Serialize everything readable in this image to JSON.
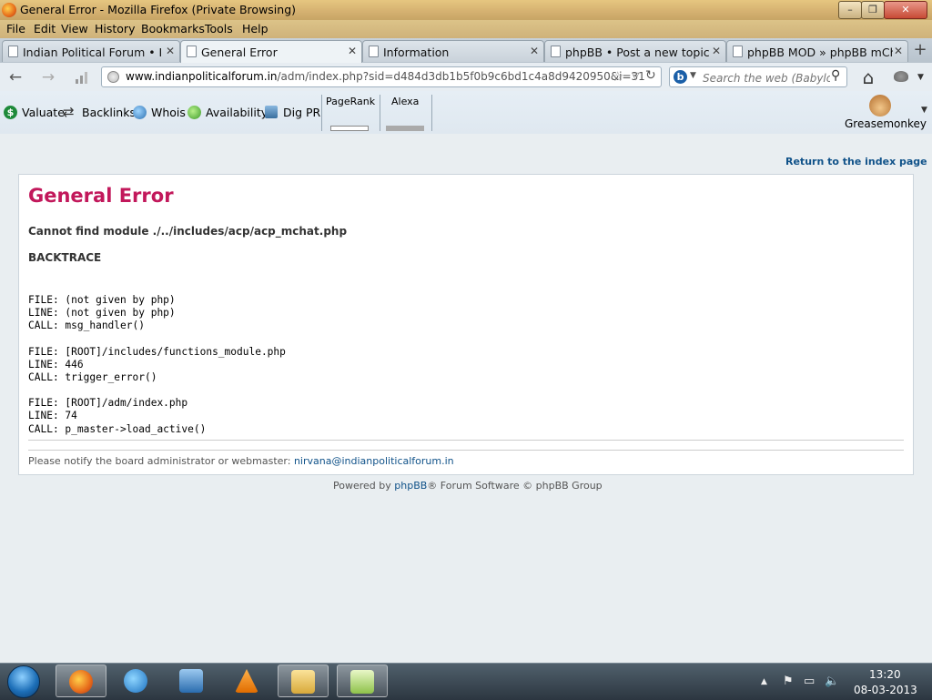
{
  "window": {
    "title": "General Error - Mozilla Firefox (Private Browsing)",
    "min_label": "–",
    "max_label": "❐",
    "close_label": "✕"
  },
  "menu": [
    "File",
    "Edit",
    "View",
    "History",
    "Bookmarks",
    "Tools",
    "Help"
  ],
  "tabs": [
    {
      "label": "Indian Political Forum • Ind...",
      "active": false
    },
    {
      "label": "General Error",
      "active": true
    },
    {
      "label": "Information",
      "active": false
    },
    {
      "label": "phpBB • Post a new topic",
      "active": false
    },
    {
      "label": "phpBB MOD » phpBB mChat",
      "active": false
    }
  ],
  "newtab_label": "+",
  "nav": {
    "back": "←",
    "forward": "→",
    "url_host": "www.indianpoliticalforum.in",
    "url_path": "/adm/index.php?sid=d484d3db1b5f0b9c6bd1c4a8d9420950&i=31",
    "star": "☆",
    "dropdown": "▽",
    "reload": "↻",
    "search_engine_letter": "b",
    "search_caret": "▼",
    "search_placeholder": "Search the web (Babylon)",
    "search_button": "⚲",
    "home": "⌂"
  },
  "addons": {
    "valuate": "Valuate",
    "backlinks": "Backlinks",
    "whois": "Whois",
    "availability": "Availability",
    "digpr": "Dig PR",
    "pagerank": "PageRank",
    "alexa": "Alexa",
    "greasemonkey": "Greasemonkey",
    "more": "▼"
  },
  "page": {
    "return_link": "Return to the index page",
    "error_title": "General Error",
    "error_message": "Cannot find module ./../includes/acp/acp_mchat.php",
    "backtrace_label": "BACKTRACE",
    "trace": "FILE: (not given by php)\nLINE: (not given by php)\nCALL: msg_handler()\n\nFILE: [ROOT]/includes/functions_module.php\nLINE: 446\nCALL: trigger_error()\n\nFILE: [ROOT]/adm/index.php\nLINE: 74\nCALL: p_master->load_active()",
    "notify_text": "Please notify the board administrator or webmaster: ",
    "notify_email": "nirvana@indianpoliticalforum.in",
    "powered_prefix": "Powered by ",
    "powered_link": "phpBB",
    "powered_suffix": "® Forum Software © phpBB Group"
  },
  "taskbar": {
    "clock_time": "13:20",
    "clock_date": "08-03-2013",
    "tray_arrow": "▲"
  },
  "colors": {
    "error_title": "#c2185b",
    "link": "#105289"
  }
}
